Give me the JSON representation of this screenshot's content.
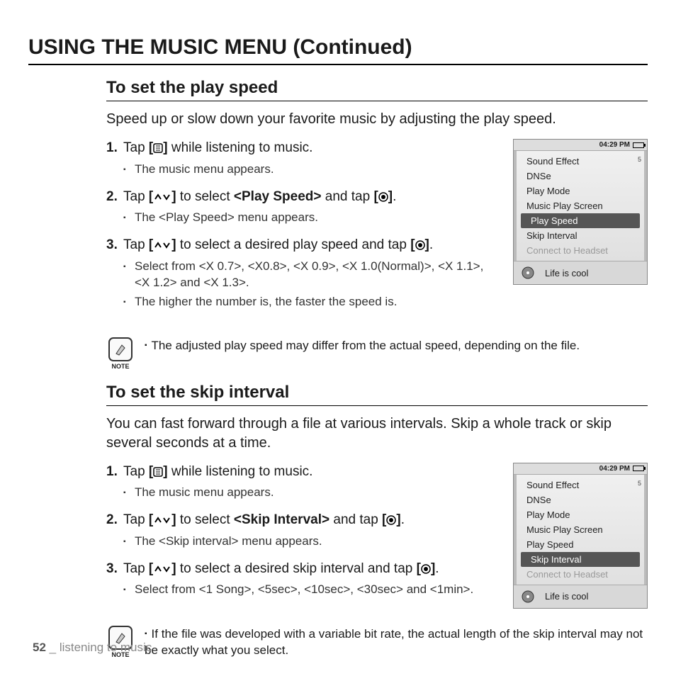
{
  "page_title": "USING THE MUSIC MENU (Continued)",
  "sections": [
    {
      "title": "To set the play speed",
      "intro": "Speed up or slow down your favorite music by adjusting the play speed.",
      "steps": [
        {
          "num": "1.",
          "pre": "Tap ",
          "icon": "menu",
          "post": " while listening to music.",
          "subs": [
            "The music menu appears."
          ]
        },
        {
          "num": "2.",
          "pre": "Tap ",
          "icon": "updown",
          "mid": " to select ",
          "bold": "<Play Speed>",
          "mid2": " and tap ",
          "icon2": "select",
          "post": ".",
          "subs": [
            "The <Play Speed> menu appears."
          ]
        },
        {
          "num": "3.",
          "pre": "Tap ",
          "icon": "updown",
          "mid": " to select a desired play speed and tap ",
          "icon2": "select",
          "post": ".",
          "subs": [
            "Select from <X 0.7>, <X0.8>, <X 0.9>, <X 1.0(Normal)>, <X 1.1>, <X 1.2> and <X 1.3>.",
            "The higher the number is, the faster the speed is."
          ]
        }
      ],
      "device_selected": "Play Speed",
      "note": "The adjusted play speed may differ from the actual speed, depending on the file."
    },
    {
      "title": "To set the skip interval",
      "intro": "You can fast forward through a file at various intervals. Skip a whole track or skip several seconds at a time.",
      "steps": [
        {
          "num": "1.",
          "pre": "Tap ",
          "icon": "menu",
          "post": " while listening to music.",
          "subs": [
            "The music menu appears."
          ]
        },
        {
          "num": "2.",
          "pre": "Tap ",
          "icon": "updown",
          "mid": " to select ",
          "bold": "<Skip Interval>",
          "mid2": " and tap ",
          "icon2": "select",
          "post": ".",
          "subs": [
            "The <Skip interval> menu appears."
          ]
        },
        {
          "num": "3.",
          "pre": "Tap ",
          "icon": "updown",
          "mid": " to select a desired skip interval and tap ",
          "icon2": "select",
          "post": ".",
          "subs": [
            "Select from <1 Song>, <5sec>, <10sec>, <30sec> and <1min>."
          ]
        }
      ],
      "device_selected": "Skip Interval",
      "note": "If the file was developed with a variable bit rate, the actual length of the skip interval may not be exactly what you select."
    }
  ],
  "device": {
    "time": "04:29 PM",
    "menu": [
      "Sound Effect",
      "DNSe",
      "Play Mode",
      "Music Play Screen",
      "Play Speed",
      "Skip Interval",
      "Connect to Headset"
    ],
    "badge": "5",
    "now_playing": "Life is cool"
  },
  "note_label": "NOTE",
  "footer": {
    "page": "52",
    "sep": " _ ",
    "chapter": "listening to music"
  }
}
